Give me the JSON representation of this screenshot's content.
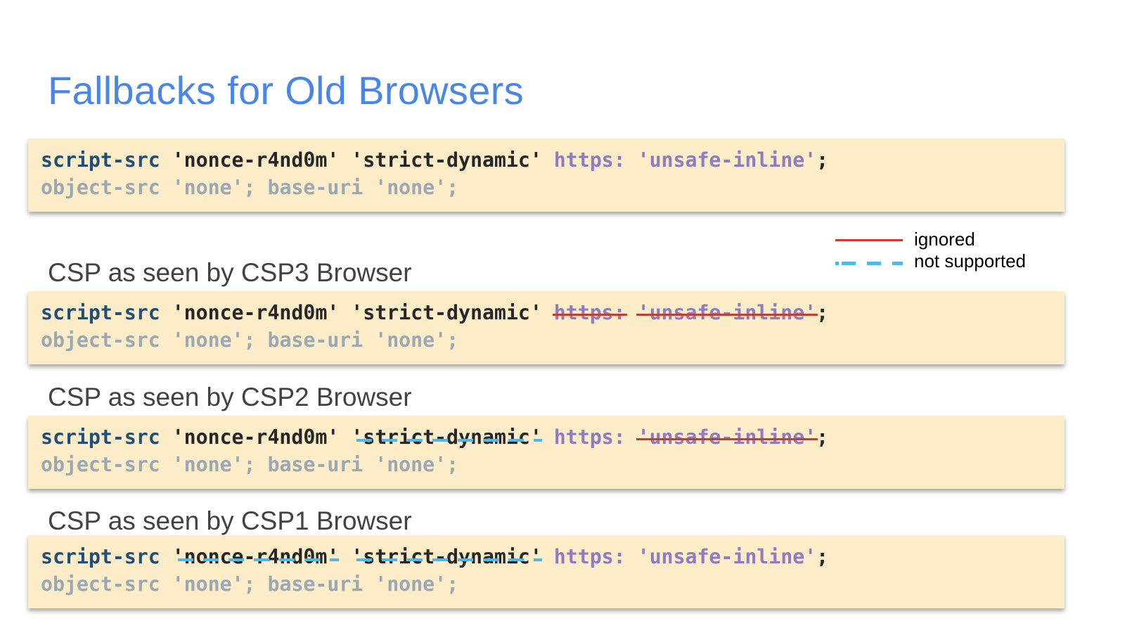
{
  "slide": {
    "title": "Fallbacks for Old Browsers"
  },
  "colors": {
    "title": "#4a86e8",
    "label": "#424242",
    "box_bg": "#fcecc7",
    "directive": "#1f4e79",
    "value": "#262626",
    "scheme": "#8e7cc3",
    "faded": "#9aa7b4",
    "ignored": "#cc3b2e",
    "not_supported": "#4fb8e6"
  },
  "legend": {
    "ignored": "ignored",
    "not_supported": "not supported"
  },
  "policy": {
    "script_src": "script-src",
    "nonce": "'nonce-r4nd0m'",
    "strict_dynamic": "'strict-dynamic'",
    "https": "https:",
    "unsafe_inline": "'unsafe-inline'",
    "terminator": ";",
    "object_src": "object-src",
    "none_1": "'none'",
    "separator": ";",
    "base_uri": "base-uri",
    "none_2": "'none'",
    "end": ";"
  },
  "sections": [
    {
      "label": ""
    },
    {
      "label": "CSP as seen by CSP3 Browser",
      "ignored": [
        "https",
        "unsafe_inline"
      ]
    },
    {
      "label": "CSP as seen by CSP2 Browser",
      "ignored": [
        "unsafe_inline"
      ],
      "not_supported": [
        "strict_dynamic"
      ]
    },
    {
      "label": "CSP as seen by CSP1 Browser",
      "not_supported": [
        "nonce",
        "strict_dynamic"
      ]
    }
  ]
}
